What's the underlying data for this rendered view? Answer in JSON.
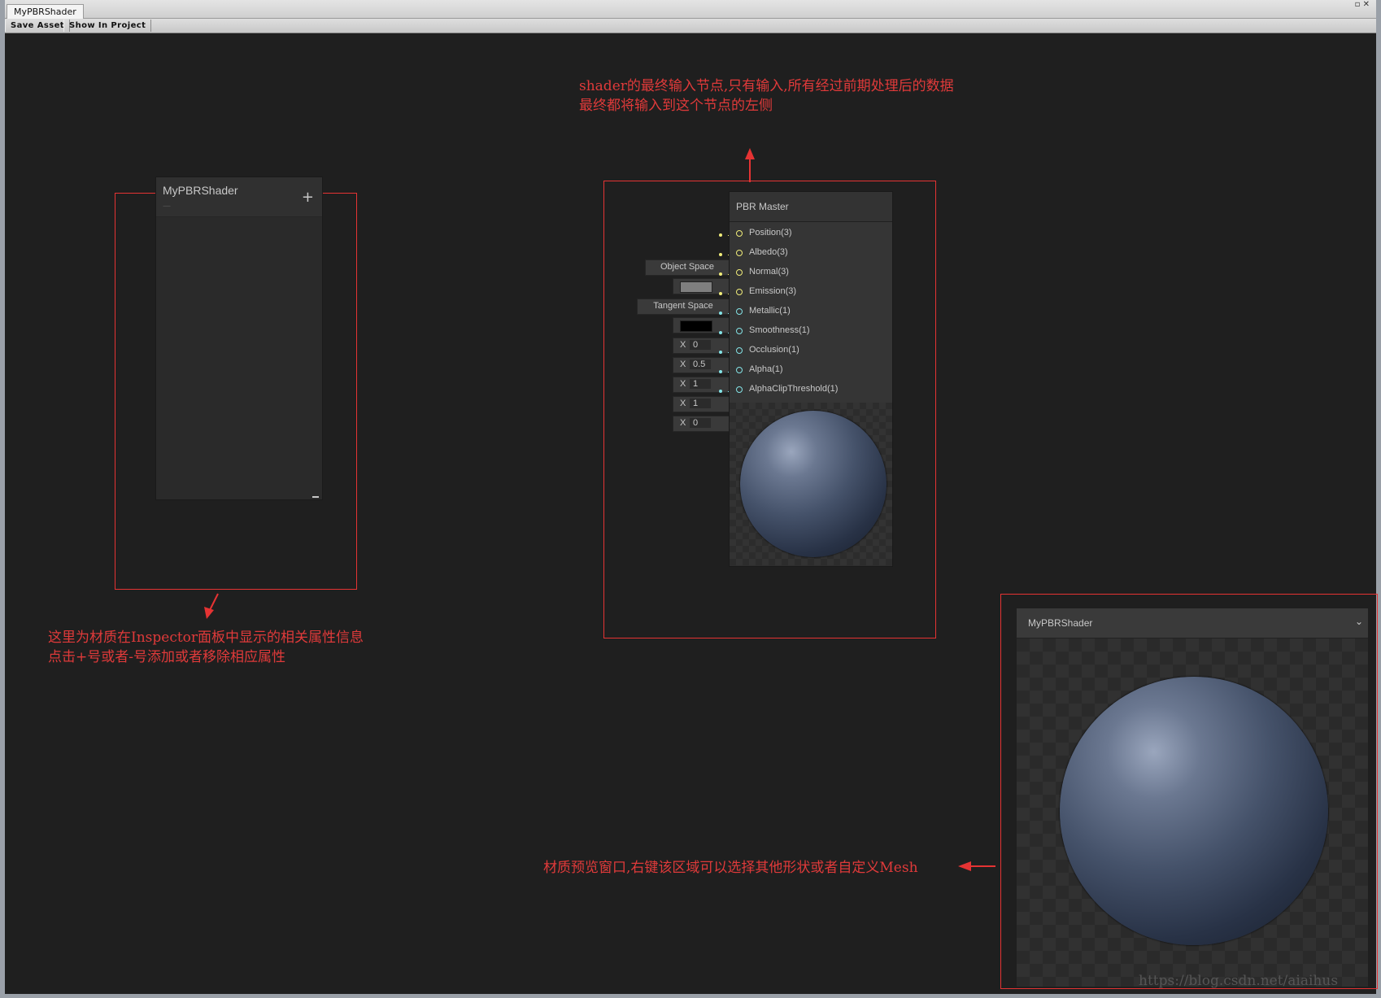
{
  "window": {
    "tab_title": "MyPBRShader",
    "controls": "▫ ✕"
  },
  "toolbar": {
    "save_asset": "Save Asset",
    "show_in_project": "Show In Project"
  },
  "blackboard": {
    "title": "MyPBRShader",
    "subtitle": "—",
    "add_symbol": "+"
  },
  "master_node": {
    "title": "PBR Master",
    "ports": [
      {
        "label": "Position(3)",
        "type": "vector3",
        "input_text": "Object Space"
      },
      {
        "label": "Albedo(3)",
        "type": "color",
        "swatch": "#7f7f7f"
      },
      {
        "label": "Normal(3)",
        "type": "vector3",
        "input_text": "Tangent Space"
      },
      {
        "label": "Emission(3)",
        "type": "color",
        "swatch": "#000000"
      },
      {
        "label": "Metallic(1)",
        "type": "float",
        "axis": "X",
        "value": "0"
      },
      {
        "label": "Smoothness(1)",
        "type": "float",
        "axis": "X",
        "value": "0.5"
      },
      {
        "label": "Occlusion(1)",
        "type": "float",
        "axis": "X",
        "value": "1"
      },
      {
        "label": "Alpha(1)",
        "type": "float",
        "axis": "X",
        "value": "1"
      },
      {
        "label": "AlphaClipThreshold(1)",
        "type": "float",
        "axis": "X",
        "value": "0"
      }
    ],
    "colors": {
      "vector3_port": "#f1ed7a",
      "float_port": "#84e4e7"
    }
  },
  "main_preview": {
    "title": "MyPBRShader",
    "chevron": "⌄"
  },
  "annotations": {
    "master_line1": "shader的最终输入节点,只有输入,所有经过前期处理后的数据",
    "master_line2": "最终都将输入到这个节点的左侧",
    "blackboard_line1": "这里为材质在Inspector面板中显示的相关属性信息",
    "blackboard_line2": "点击+号或者-号添加或者移除相应属性",
    "preview_line": "材质预览窗口,右键该区域可以选择其他形状或者自定义Mesh",
    "color": "#e03a3a"
  },
  "watermark": "https://blog.csdn.net/aiaihus"
}
